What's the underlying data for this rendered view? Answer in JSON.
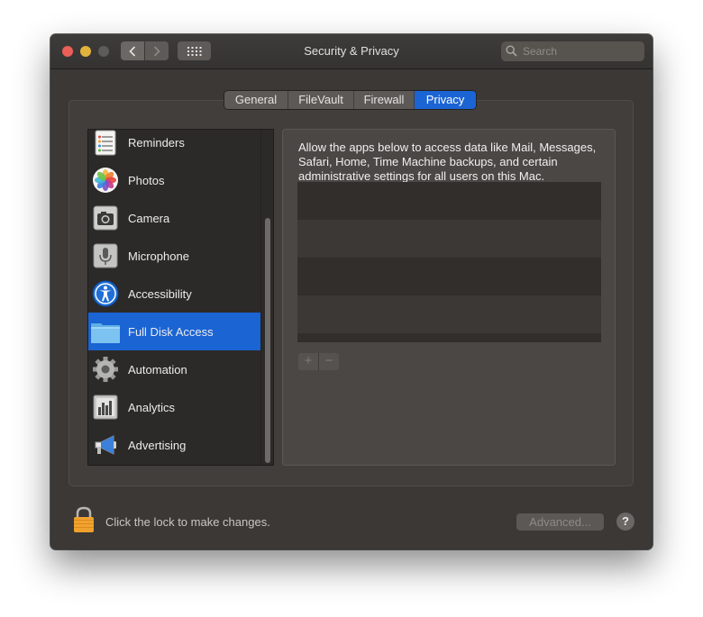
{
  "window": {
    "title": "Security & Privacy"
  },
  "search": {
    "placeholder": "Search"
  },
  "tabs": [
    {
      "label": "General"
    },
    {
      "label": "FileVault"
    },
    {
      "label": "Firewall"
    },
    {
      "label": "Privacy"
    }
  ],
  "sidebar": {
    "items": [
      {
        "label": "Reminders",
        "icon": "reminders-icon"
      },
      {
        "label": "Photos",
        "icon": "photos-icon"
      },
      {
        "label": "Camera",
        "icon": "camera-icon"
      },
      {
        "label": "Microphone",
        "icon": "microphone-icon"
      },
      {
        "label": "Accessibility",
        "icon": "accessibility-icon"
      },
      {
        "label": "Full Disk Access",
        "icon": "folder-icon"
      },
      {
        "label": "Automation",
        "icon": "gear-icon"
      },
      {
        "label": "Analytics",
        "icon": "analytics-icon"
      },
      {
        "label": "Advertising",
        "icon": "megaphone-icon"
      }
    ],
    "selected": "Full Disk Access"
  },
  "main": {
    "description": "Allow the apps below to access data like Mail, Messages, Safari, Home, Time Machine backups, and certain administrative settings for all users on this Mac.",
    "add_label": "+",
    "remove_label": "−"
  },
  "footer": {
    "lock_text": "Click the lock to make changes.",
    "advanced_label": "Advanced...",
    "help_label": "?"
  },
  "colors": {
    "accent": "#1b64d4",
    "window_bg": "#3b3835"
  }
}
